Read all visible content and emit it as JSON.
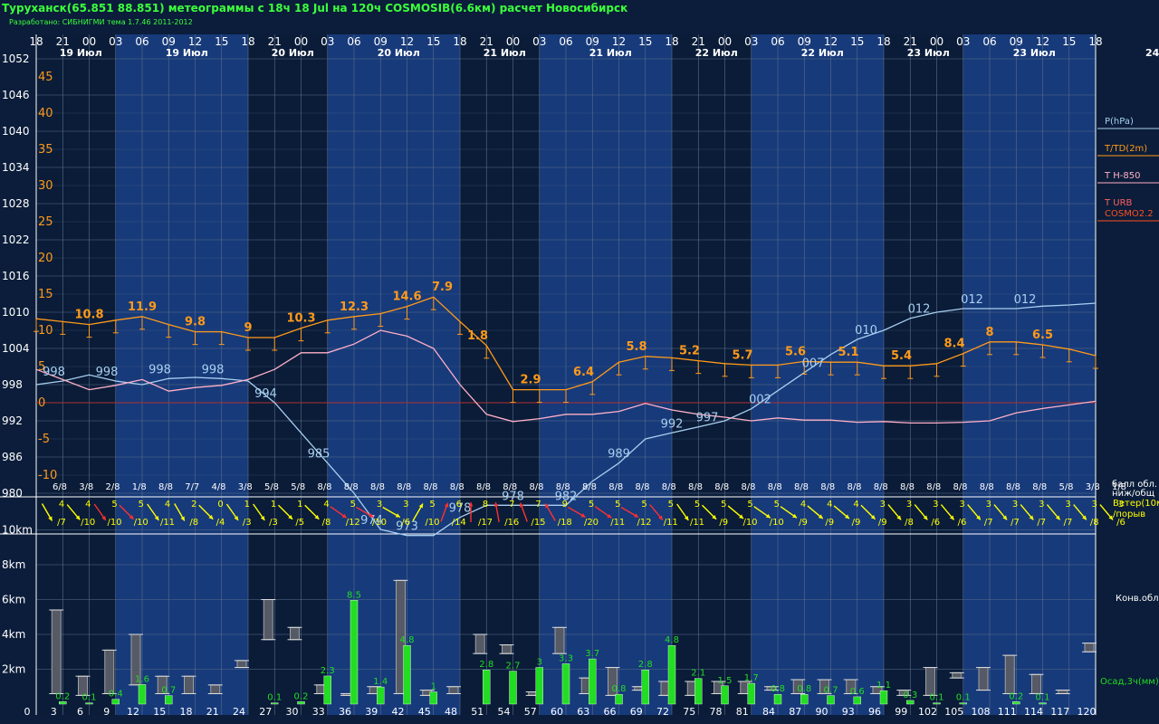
{
  "header": {
    "title": "Туруханск(65.851 88.851) метеограммы с  18ч 18 Jul на 120ч COSMOSIB(6.6км) расчет Новосибирск",
    "subtitle": "Разработано: СИБНИГМИ тема 1.7.46 2011-2012"
  },
  "colors": {
    "pressure": "#a8cff0",
    "temperature": "#ff9a1a",
    "t850": "#ffb0c8",
    "zero_line": "#b03030",
    "wind": "#ffff00",
    "wind_strong": "#ff3030",
    "precip": "#22dd22",
    "cloud": "#a0a0a0",
    "day_band": "#173a7a",
    "night_band": "#0a1c38",
    "grid": "#5a6e8a"
  },
  "legend": {
    "p": "P(hPa)",
    "t": "T/TD(2m)",
    "t850": "T H-850",
    "turb": "T URB",
    "cosmo": "COSMO2.2",
    "cloud_ball": "балл обл.",
    "cloud_ball2": "ниж/общ",
    "wind": "Ветер(10м",
    "gust": "/порыв",
    "conv": "Конв.обл.",
    "precip": "Осад,3ч(мм)"
  },
  "top_axis": {
    "hours": [
      "18",
      "21",
      "00",
      "03",
      "06",
      "09",
      "12",
      "15",
      "18",
      "21",
      "00",
      "03",
      "06",
      "09",
      "12",
      "15",
      "18",
      "21",
      "00",
      "03",
      "06",
      "09",
      "12",
      "15",
      "18",
      "21",
      "00",
      "03",
      "06",
      "09",
      "12",
      "15",
      "18",
      "21",
      "00",
      "03",
      "06",
      "09",
      "12",
      "15",
      "18"
    ],
    "dates": [
      {
        "i": 1,
        "label": "19 Июл"
      },
      {
        "i": 5,
        "label": "19 Июл"
      },
      {
        "i": 9,
        "label": "20 Июл"
      },
      {
        "i": 13,
        "label": "20 Июл"
      },
      {
        "i": 17,
        "label": "21 Июл"
      },
      {
        "i": 21,
        "label": "21 Июл"
      },
      {
        "i": 25,
        "label": "22 Июл"
      },
      {
        "i": 29,
        "label": "22 Июл"
      },
      {
        "i": 33,
        "label": "23 Июл"
      },
      {
        "i": 37,
        "label": "23 Июл"
      },
      {
        "i": 42,
        "label": "24 Июл"
      }
    ]
  },
  "bottom_axis": [
    "0",
    "3",
    "6",
    "9",
    "12",
    "15",
    "18",
    "21",
    "24",
    "27",
    "30",
    "33",
    "36",
    "39",
    "42",
    "45",
    "48",
    "51",
    "54",
    "57",
    "60",
    "63",
    "66",
    "69",
    "72",
    "75",
    "78",
    "81",
    "84",
    "87",
    "90",
    "93",
    "96",
    "99",
    "102",
    "105",
    "108",
    "111",
    "114",
    "117",
    "120"
  ],
  "pressure_axis": [
    "1052",
    "1046",
    "1040",
    "1034",
    "1028",
    "1022",
    "1016",
    "1010",
    "1004",
    "998",
    "992",
    "986",
    "980"
  ],
  "temp_axis": [
    "45",
    "40",
    "35",
    "30",
    "25",
    "20",
    "15",
    "10",
    "5",
    "0",
    "-5",
    "-10"
  ],
  "height_axis": [
    "10km",
    "8km",
    "6km",
    "4km",
    "2km"
  ],
  "chart_data": {
    "type": "line",
    "x_hours": [
      0,
      3,
      6,
      9,
      12,
      15,
      18,
      21,
      24,
      27,
      30,
      33,
      36,
      39,
      42,
      45,
      48,
      51,
      54,
      57,
      60,
      63,
      66,
      69,
      72,
      75,
      78,
      81,
      84,
      87,
      90,
      93,
      96,
      99,
      102,
      105,
      108,
      111,
      114,
      117,
      120
    ],
    "series": [
      {
        "name": "P(hPa)",
        "values": [
          998,
          998.6,
          999.6,
          998.6,
          998,
          999,
          999.2,
          999,
          998.6,
          995,
          990,
          985,
          980,
          974,
          973,
          973,
          976,
          978,
          978,
          978,
          978,
          982,
          985,
          989,
          990,
          991,
          992,
          994,
          997,
          1000,
          1003,
          1005.5,
          1007,
          1009,
          1010,
          1010.6,
          1010.6,
          1010.6,
          1011,
          1011.2,
          1011.5
        ]
      },
      {
        "name": "T/TD(2m)",
        "values": [
          11.6,
          11.2,
          10.8,
          11.4,
          11.9,
          10.8,
          9.8,
          9.8,
          9,
          9,
          10.3,
          11.4,
          11.9,
          12.3,
          13.3,
          14.6,
          11.2,
          7.9,
          1.8,
          1.8,
          1.8,
          2.9,
          5.6,
          6.4,
          6.2,
          5.8,
          5.4,
          5.2,
          5.2,
          5.7,
          5.6,
          5.6,
          5.1,
          5.1,
          5.4,
          6.8,
          8.4,
          8.4,
          8,
          7.4,
          6.5
        ]
      },
      {
        "name": "T H-850",
        "values": [
          4.6,
          3.2,
          1.8,
          2.4,
          3.2,
          1.6,
          2.1,
          2.4,
          3.2,
          4.6,
          6.9,
          6.9,
          8.1,
          10,
          9.2,
          7.5,
          2.5,
          -1.6,
          -2.6,
          -2.2,
          -1.6,
          -1.6,
          -1.2,
          -0.1,
          -1,
          -1.6,
          -2,
          -2.5,
          -2.1,
          -2.4,
          -2.4,
          -2.7,
          -2.6,
          -2.8,
          -2.8,
          -2.7,
          -2.5,
          -1.4,
          -0.8,
          -0.3,
          0.2
        ]
      }
    ],
    "pressure_labels": [
      {
        "h": 3,
        "v": "998"
      },
      {
        "h": 12,
        "v": "998"
      },
      {
        "h": 21,
        "v": "998"
      },
      {
        "h": 30,
        "v": "998"
      },
      {
        "h": 39,
        "v": "994"
      },
      {
        "h": 48,
        "v": "985"
      },
      {
        "h": 57,
        "v": "974"
      },
      {
        "h": 63,
        "v": "973"
      },
      {
        "h": 72,
        "v": "978"
      },
      {
        "h": 81,
        "v": "978"
      },
      {
        "h": 90,
        "v": "982"
      },
      {
        "h": 99,
        "v": "989"
      },
      {
        "h": 108,
        "v": "992"
      },
      {
        "h": 114,
        "v": "997"
      },
      {
        "h": 123,
        "v": "002"
      },
      {
        "h": 132,
        "v": "007"
      },
      {
        "h": 141,
        "v": "010"
      },
      {
        "h": 150,
        "v": "012"
      },
      {
        "h": 159,
        "v": "012"
      },
      {
        "h": 168,
        "v": "012"
      }
    ],
    "temp_labels": [
      {
        "h": 9,
        "v": "10.8"
      },
      {
        "h": 18,
        "v": "11.9"
      },
      {
        "h": 27,
        "v": "9.8"
      },
      {
        "h": 36,
        "v": "9"
      },
      {
        "h": 45,
        "v": "10.3"
      },
      {
        "h": 54,
        "v": "12.3"
      },
      {
        "h": 63,
        "v": "14.6"
      },
      {
        "h": 69,
        "v": "7.9"
      },
      {
        "h": 75,
        "v": "1.8"
      },
      {
        "h": 84,
        "v": "2.9"
      },
      {
        "h": 93,
        "v": "6.4"
      },
      {
        "h": 102,
        "v": "5.8"
      },
      {
        "h": 111,
        "v": "5.2"
      },
      {
        "h": 120,
        "v": "5.7"
      },
      {
        "h": 129,
        "v": "5.6"
      },
      {
        "h": 138,
        "v": "5.1"
      },
      {
        "h": 147,
        "v": "5.4"
      },
      {
        "h": 156,
        "v": "8.4"
      },
      {
        "h": 162,
        "v": "8"
      },
      {
        "h": 171,
        "v": "6.5"
      }
    ],
    "cloud_fraction": [
      "6/8",
      "3/8",
      "2/8",
      "1/8",
      "8/8",
      "7/7",
      "4/8",
      "3/8",
      "5/8",
      "5/8",
      "8/8",
      "8/8",
      "8/8",
      "8/8",
      "8/8",
      "8/8",
      "8/8",
      "8/8",
      "8/8",
      "8/8",
      "8/8",
      "8/8",
      "8/8",
      "8/8",
      "8/8",
      "8/8",
      "8/8",
      "8/8",
      "8/8",
      "8/8",
      "8/8",
      "8/8",
      "8/8",
      "8/8",
      "8/8",
      "8/8",
      "8/8",
      "8/8",
      "5/8",
      "3/8",
      "1/8"
    ],
    "wind_speed": [
      "4",
      "4",
      "5",
      "5",
      "4",
      "2",
      "0",
      "1",
      "1",
      "1",
      "4",
      "5",
      "3",
      "3",
      "5",
      "6",
      "8",
      "7",
      "7",
      "9",
      "5",
      "5",
      "5",
      "5",
      "5",
      "5",
      "5",
      "5",
      "4",
      "4",
      "4",
      "3",
      "3",
      "3",
      "3",
      "3",
      "3",
      "3",
      "3",
      "3",
      "3"
    ],
    "wind_gust": [
      "/7",
      "/10",
      "/10",
      "/10",
      "/11",
      "/8",
      "/4",
      "/3",
      "/3",
      "/5",
      "/8",
      "/12",
      "/10",
      "/6",
      "/10",
      "/14",
      "/17",
      "/16",
      "/15",
      "/18",
      "/20",
      "/11",
      "/12",
      "/11",
      "/11",
      "/9",
      "/10",
      "/10",
      "/9",
      "/9",
      "/9",
      "/9",
      "/8",
      "/6",
      "/6",
      "/7",
      "/7",
      "/7",
      "/7",
      "/8",
      "/6"
    ],
    "wind_strong": [
      false,
      false,
      true,
      true,
      false,
      false,
      false,
      false,
      false,
      false,
      false,
      true,
      true,
      false,
      false,
      true,
      true,
      true,
      true,
      true,
      true,
      true,
      true,
      true,
      false,
      false,
      false,
      false,
      false,
      false,
      false,
      false,
      false,
      false,
      false,
      false,
      false,
      false,
      false,
      false,
      false
    ],
    "wind_dir_deg": [
      30,
      40,
      35,
      45,
      35,
      30,
      45,
      35,
      35,
      45,
      45,
      55,
      60,
      60,
      150,
      160,
      180,
      190,
      200,
      210,
      60,
      55,
      60,
      40,
      35,
      45,
      50,
      55,
      55,
      50,
      50,
      45,
      40,
      40,
      40,
      40,
      40,
      40,
      40,
      40,
      40
    ],
    "cloud_bars_km": [
      {
        "h": 3,
        "lo": 0.6,
        "hi": 5.4
      },
      {
        "h": 6,
        "lo": 0.5,
        "hi": 1.6
      },
      {
        "h": 9,
        "lo": 0.6,
        "hi": 3.1
      },
      {
        "h": 12,
        "lo": 1.1,
        "hi": 4
      },
      {
        "h": 15,
        "lo": 0.6,
        "hi": 1.6
      },
      {
        "h": 18,
        "lo": 0.6,
        "hi": 1.6
      },
      {
        "h": 21,
        "lo": 0.6,
        "hi": 1.1
      },
      {
        "h": 24,
        "lo": 2.1,
        "hi": 2.5
      },
      {
        "h": 27,
        "lo": 3.7,
        "hi": 6
      },
      {
        "h": 30,
        "lo": 3.7,
        "hi": 4.4
      },
      {
        "h": 33,
        "lo": 0.6,
        "hi": 1.1
      },
      {
        "h": 36,
        "lo": 0.5,
        "hi": 0.6
      },
      {
        "h": 39,
        "lo": 0.6,
        "hi": 1
      },
      {
        "h": 42,
        "lo": 0.6,
        "hi": 7.1
      },
      {
        "h": 45,
        "lo": 0.5,
        "hi": 0.8
      },
      {
        "h": 48,
        "lo": 0.6,
        "hi": 1
      },
      {
        "h": 51,
        "lo": 2.9,
        "hi": 4
      },
      {
        "h": 54,
        "lo": 2.9,
        "hi": 3.4
      },
      {
        "h": 57,
        "lo": 0.5,
        "hi": 0.7
      },
      {
        "h": 60,
        "lo": 2.9,
        "hi": 4.4
      },
      {
        "h": 63,
        "lo": 0.6,
        "hi": 1.5
      },
      {
        "h": 66,
        "lo": 0.5,
        "hi": 2.1
      },
      {
        "h": 69,
        "lo": 0.8,
        "hi": 1
      },
      {
        "h": 72,
        "lo": 0.5,
        "hi": 1.3
      },
      {
        "h": 75,
        "lo": 0.5,
        "hi": 1.3
      },
      {
        "h": 78,
        "lo": 0.6,
        "hi": 1.3
      },
      {
        "h": 81,
        "lo": 0.6,
        "hi": 1.3
      },
      {
        "h": 84,
        "lo": 0.8,
        "hi": 1
      },
      {
        "h": 87,
        "lo": 0.6,
        "hi": 1.4
      },
      {
        "h": 90,
        "lo": 0.6,
        "hi": 1.4
      },
      {
        "h": 93,
        "lo": 0.6,
        "hi": 1.4
      },
      {
        "h": 96,
        "lo": 0.6,
        "hi": 1
      },
      {
        "h": 99,
        "lo": 0.5,
        "hi": 0.8
      },
      {
        "h": 102,
        "lo": 0.5,
        "hi": 2.1
      },
      {
        "h": 105,
        "lo": 1.5,
        "hi": 1.8
      },
      {
        "h": 108,
        "lo": 0.8,
        "hi": 2.1
      },
      {
        "h": 111,
        "lo": 0.6,
        "hi": 2.8
      },
      {
        "h": 114,
        "lo": 0.6,
        "hi": 1.7
      },
      {
        "h": 117,
        "lo": 0.6,
        "hi": 0.8
      },
      {
        "h": 120,
        "lo": 3,
        "hi": 3.5
      }
    ],
    "precip_mm": [
      {
        "h": 3,
        "v": 0.2,
        "label": "0.2"
      },
      {
        "h": 6,
        "v": 0.1,
        "label": "0.1"
      },
      {
        "h": 9,
        "v": 0.4,
        "label": "0.4"
      },
      {
        "h": 12,
        "v": 1.6,
        "label": "1.6"
      },
      {
        "h": 15,
        "v": 0.7,
        "label": "0.7"
      },
      {
        "h": 27,
        "v": 0.1,
        "label": "0.1"
      },
      {
        "h": 30,
        "v": 0.2,
        "label": "0.2"
      },
      {
        "h": 33,
        "v": 2.3,
        "label": "2.3"
      },
      {
        "h": 36,
        "v": 8.5,
        "label": "8.5"
      },
      {
        "h": 39,
        "v": 1.4,
        "label": "1.4"
      },
      {
        "h": 42,
        "v": 4.8,
        "label": "4.8"
      },
      {
        "h": 45,
        "v": 1,
        "label": "1"
      },
      {
        "h": 51,
        "v": 2.8,
        "label": "2.8"
      },
      {
        "h": 54,
        "v": 2.7,
        "label": "2.7"
      },
      {
        "h": 57,
        "v": 3,
        "label": "3"
      },
      {
        "h": 60,
        "v": 3.3,
        "label": "3.3"
      },
      {
        "h": 63,
        "v": 3.7,
        "label": "3.7"
      },
      {
        "h": 66,
        "v": 0.8,
        "label": "0.8"
      },
      {
        "h": 69,
        "v": 2.8,
        "label": "2.8"
      },
      {
        "h": 72,
        "v": 4.8,
        "label": "4.8"
      },
      {
        "h": 75,
        "v": 2.1,
        "label": "2.1"
      },
      {
        "h": 78,
        "v": 1.5,
        "label": "1.5"
      },
      {
        "h": 81,
        "v": 1.7,
        "label": "1.7"
      },
      {
        "h": 84,
        "v": 0.8,
        "label": "0.8"
      },
      {
        "h": 87,
        "v": 0.8,
        "label": "0.8"
      },
      {
        "h": 90,
        "v": 0.7,
        "label": "0.7"
      },
      {
        "h": 93,
        "v": 0.6,
        "label": "0.6"
      },
      {
        "h": 96,
        "v": 1.1,
        "label": "1.1"
      },
      {
        "h": 99,
        "v": 0.3,
        "label": "0.3"
      },
      {
        "h": 102,
        "v": 0.1,
        "label": "0.1"
      },
      {
        "h": 105,
        "v": 0.1,
        "label": "0.1"
      },
      {
        "h": 111,
        "v": 0.2,
        "label": "0.2"
      },
      {
        "h": 114,
        "v": 0.1,
        "label": "0.1"
      }
    ],
    "pressure_range": [
      980,
      1052
    ],
    "temp_range": [
      -10,
      45
    ]
  }
}
